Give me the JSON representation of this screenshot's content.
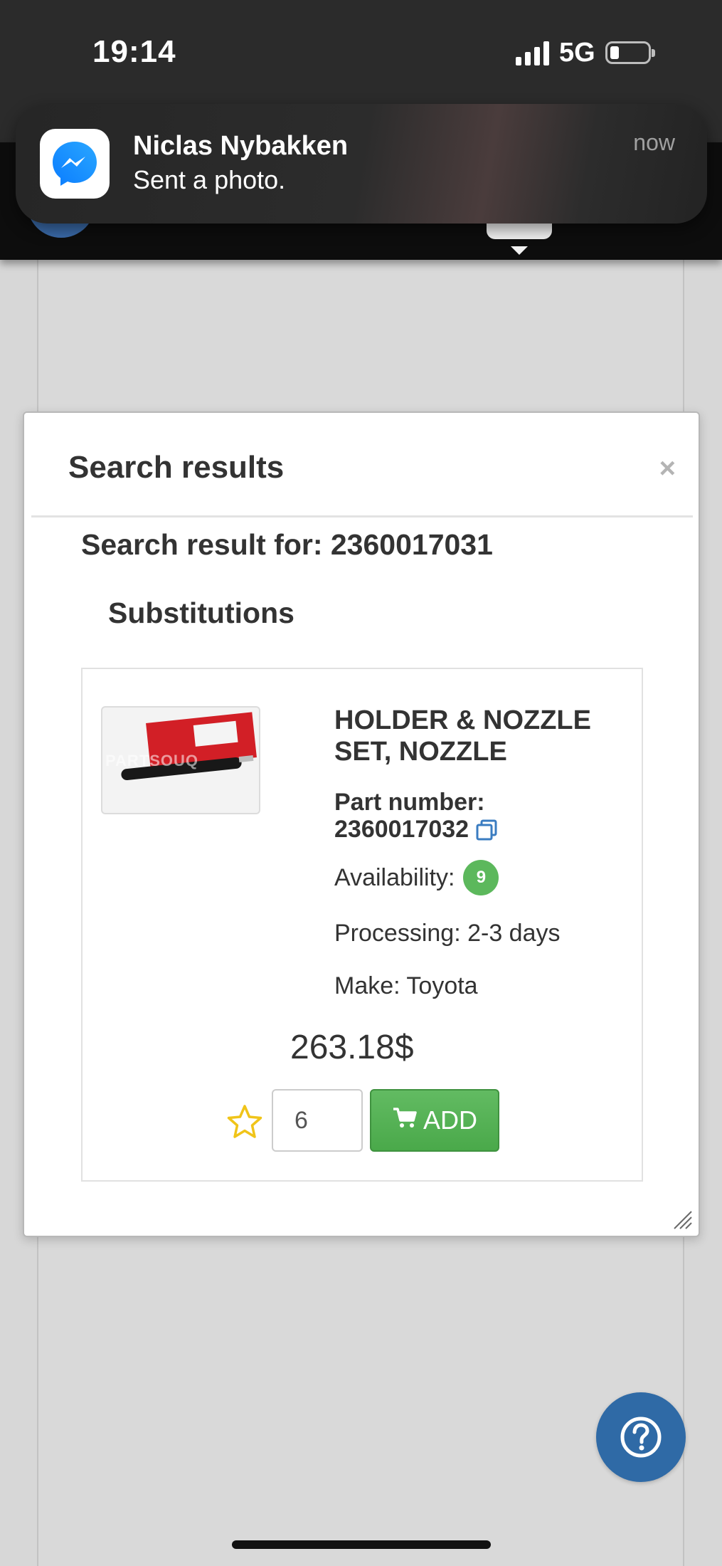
{
  "status_bar": {
    "time": "19:14",
    "network": "5G",
    "battery_level": 0.2
  },
  "notification": {
    "app_icon": "messenger-icon",
    "sender": "Niclas Nybakken",
    "message": "Sent a photo.",
    "time": "now"
  },
  "modal": {
    "title": "Search results",
    "close_label": "×",
    "search_result_text": "Search result for: 2360017031",
    "section_title": "Substitutions"
  },
  "product": {
    "name": "HOLDER & NOZZLE SET, NOZZLE",
    "part_number_label": "Part number:",
    "part_number": "2360017032",
    "availability_label": "Availability:",
    "availability_count": "9",
    "processing": "Processing: 2-3 days",
    "make": "Make: Toyota",
    "price": "263.18$",
    "image_watermark": "PARTSOUQ",
    "quantity": "6",
    "add_label": "ADD"
  },
  "colors": {
    "add_button": "#5cb85c",
    "availability_badge": "#5cb85c",
    "help_button": "#2f6aa6",
    "favorite_star": "#f0c419",
    "copy_icon": "#3a7cc1"
  },
  "icons": {
    "favorite": "star-icon",
    "copy": "copy-icon",
    "cart": "cart-icon",
    "help": "question-icon"
  }
}
